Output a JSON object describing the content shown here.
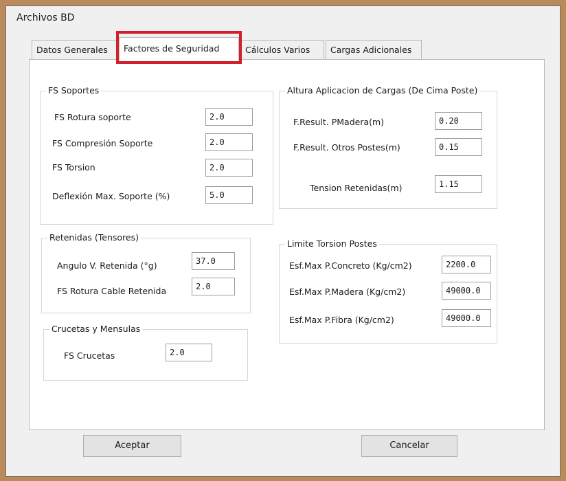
{
  "window": {
    "title": "Archivos BD"
  },
  "tabs": [
    {
      "label": "Datos Generales"
    },
    {
      "label": "Factores de Seguridad"
    },
    {
      "label": "Cálculos Varios"
    },
    {
      "label": "Cargas Adicionales"
    }
  ],
  "active_tab": "Factores de Seguridad",
  "highlight_color": "#d0202c",
  "fs_soportes": {
    "title": "FS Soportes",
    "rows": [
      {
        "label": "FS Rotura soporte",
        "value": "2.0"
      },
      {
        "label": "FS Compresión Soporte",
        "value": "2.0"
      },
      {
        "label": "FS Torsion",
        "value": "2.0"
      },
      {
        "label": "Deflexión Max. Soporte (%)",
        "value": "5.0"
      }
    ]
  },
  "retenidas": {
    "title": "Retenidas (Tensores)",
    "rows": [
      {
        "label": "Angulo V. Retenida (°g)",
        "value": "37.0"
      },
      {
        "label": "FS Rotura Cable Retenida",
        "value": "2.0"
      }
    ]
  },
  "crucetas": {
    "title": "Crucetas y Mensulas",
    "rows": [
      {
        "label": "FS Crucetas",
        "value": "2.0"
      }
    ]
  },
  "altura": {
    "title": "Altura Aplicacion de Cargas (De Cima Poste)",
    "rows": [
      {
        "label": "F.Result. PMadera(m)",
        "value": "0.20"
      },
      {
        "label": "F.Result. Otros Postes(m)",
        "value": "0.15"
      },
      {
        "label": "Tension Retenidas(m)",
        "value": "1.15"
      }
    ]
  },
  "limite_torsion": {
    "title": "Limite Torsion Postes",
    "rows": [
      {
        "label": "Esf.Max P.Concreto (Kg/cm2)",
        "value": "2200.0"
      },
      {
        "label": "Esf.Max P.Madera (Kg/cm2)",
        "value": "49000.0"
      },
      {
        "label": "Esf.Max P.Fibra (Kg/cm2)",
        "value": "49000.0"
      }
    ]
  },
  "buttons": {
    "accept": "Aceptar",
    "cancel": "Cancelar"
  }
}
